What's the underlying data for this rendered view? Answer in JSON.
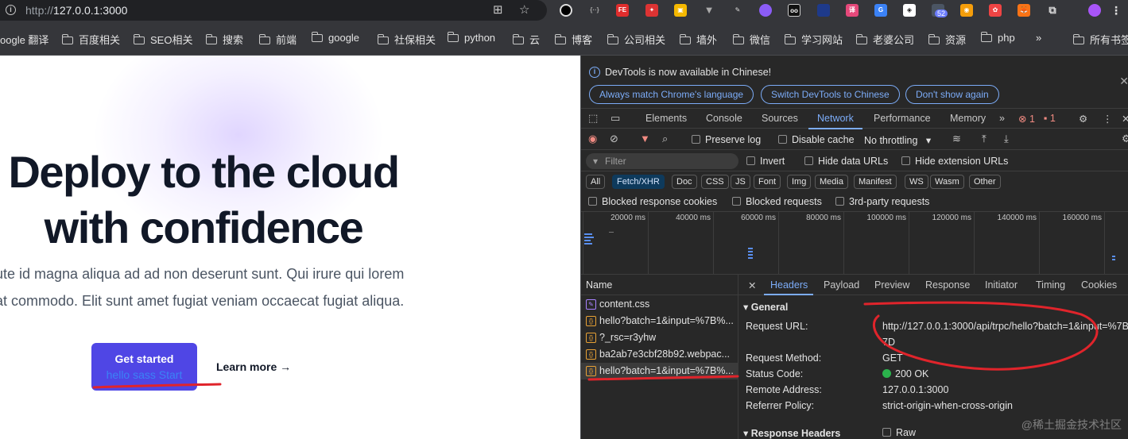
{
  "browser": {
    "url_scheme_host": "http://",
    "url_host": "127.0.0.1",
    "url_port": ":3000",
    "ext_badge": "52",
    "bookmarks": [
      "oogle 翻译",
      "百度相关",
      "SEO相关",
      "搜索",
      "前端",
      "google",
      "社保相关",
      "python",
      "云",
      "博客",
      "公司相关",
      "墙外",
      "微信",
      "学习网站",
      "老婆公司",
      "资源",
      "php",
      "»",
      "所有书签"
    ]
  },
  "page": {
    "hero_line1": "Deploy to the cloud",
    "hero_line2": "with confidence",
    "lead_line1": "ute id magna aliqua ad ad non deserunt sunt. Qui irure qui lorem",
    "lead_line2": "at commodo. Elit sunt amet fugiat veniam occaecat fugiat aliqua.",
    "cta_label": "Get started",
    "cta_sub": "hello sass Start",
    "learn_more": "Learn more →"
  },
  "devtools": {
    "info_msg": "DevTools is now available in Chinese!",
    "info_buttons": [
      "Always match Chrome's language",
      "Switch DevTools to Chinese",
      "Don't show again"
    ],
    "tabs": [
      "Elements",
      "Console",
      "Sources",
      "Network",
      "Performance",
      "Memory"
    ],
    "active_tab": "Network",
    "error_count": "1",
    "warning_count": "1",
    "toolbar": {
      "preserve_log": "Preserve log",
      "disable_cache": "Disable cache",
      "throttling": "No throttling"
    },
    "filter": {
      "placeholder": "Filter",
      "invert": "Invert",
      "hide_data_urls": "Hide data URLs",
      "hide_extension_urls": "Hide extension URLs"
    },
    "type_chips": [
      "All",
      "Fetch/XHR",
      "Doc",
      "CSS",
      "JS",
      "Font",
      "Img",
      "Media",
      "Manifest",
      "WS",
      "Wasm",
      "Other"
    ],
    "active_chip": "Fetch/XHR",
    "blocked": {
      "response_cookies": "Blocked response cookies",
      "requests": "Blocked requests",
      "third_party": "3rd-party requests"
    },
    "timeline_ticks": [
      "20000 ms",
      "40000 ms",
      "60000 ms",
      "80000 ms",
      "100000 ms",
      "120000 ms",
      "140000 ms",
      "160000 ms"
    ],
    "name_header": "Name",
    "requests": [
      {
        "name": "content.css",
        "kind": "css"
      },
      {
        "name": "hello?batch=1&input=%7B%...",
        "kind": "xhr"
      },
      {
        "name": "?_rsc=r3yhw",
        "kind": "xhr"
      },
      {
        "name": "ba2ab7e3cbf28b92.webpac...",
        "kind": "xhr"
      },
      {
        "name": "hello?batch=1&input=%7B%...",
        "kind": "xhr"
      }
    ],
    "detail_tabs": [
      "Headers",
      "Payload",
      "Preview",
      "Response",
      "Initiator",
      "Timing",
      "Cookies"
    ],
    "active_detail_tab": "Headers",
    "general": {
      "title": "General",
      "request_url_label": "Request URL:",
      "request_url_1": "http://127.0.0.1:3000/api/trpc/hello?batch=1&input=%7B",
      "request_url_2": "7D",
      "method_label": "Request Method:",
      "method": "GET",
      "status_label": "Status Code:",
      "status": "200 OK",
      "remote_label": "Remote Address:",
      "remote": "127.0.0.1:3000",
      "referrer_label": "Referrer Policy:",
      "referrer": "strict-origin-when-cross-origin"
    },
    "response_headers": "Response Headers",
    "raw": "Raw",
    "watermark": "@稀土掘金技术社区"
  }
}
